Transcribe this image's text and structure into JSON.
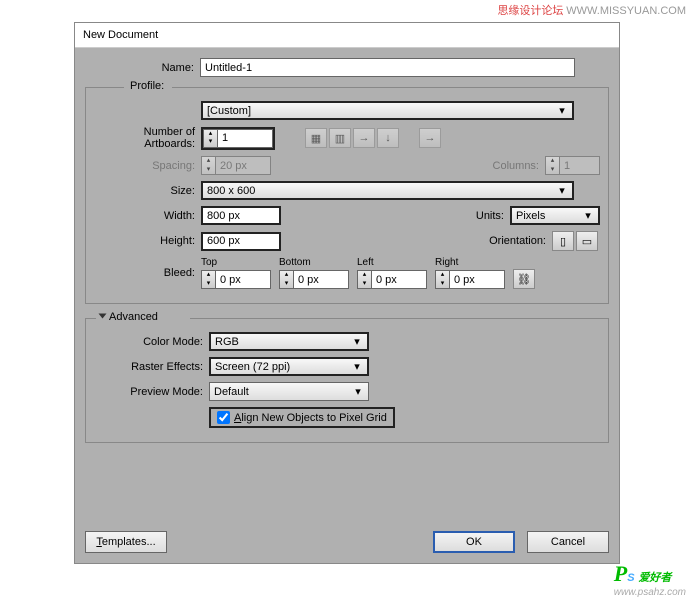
{
  "watermark": {
    "top_cn": "思缘设计论坛",
    "top_url": "WWW.MISSYUAN.COM",
    "bottom_cn": "爱好者",
    "bottom_url": "www.psahz.com"
  },
  "dialog": {
    "title": "New Document"
  },
  "fields": {
    "name_label": "Name:",
    "name_value": "Untitled-1",
    "profile_label": "Profile:",
    "profile_value": "[Custom]",
    "artboards_label": "Number of Artboards:",
    "artboards_value": "1",
    "spacing_label": "Spacing:",
    "spacing_value": "20 px",
    "columns_label": "Columns:",
    "columns_value": "1",
    "size_label": "Size:",
    "size_value": "800 x 600",
    "width_label": "Width:",
    "width_value": "800 px",
    "units_label": "Units:",
    "units_value": "Pixels",
    "height_label": "Height:",
    "height_value": "600 px",
    "orientation_label": "Orientation:",
    "bleed_label": "Bleed:",
    "bleed": {
      "top": "Top",
      "bottom": "Bottom",
      "left": "Left",
      "right": "Right",
      "value": "0 px"
    },
    "advanced_label": "Advanced",
    "colormode_label": "Color Mode:",
    "colormode_value": "RGB",
    "raster_label": "Raster Effects:",
    "raster_value": "Screen (72 ppi)",
    "preview_label": "Preview Mode:",
    "preview_value": "Default",
    "align_label": "lign New Objects to Pixel Grid",
    "align_prefix": "A"
  },
  "buttons": {
    "templates": "emplates...",
    "templates_prefix": "T",
    "ok": "OK",
    "cancel": "Cancel"
  }
}
